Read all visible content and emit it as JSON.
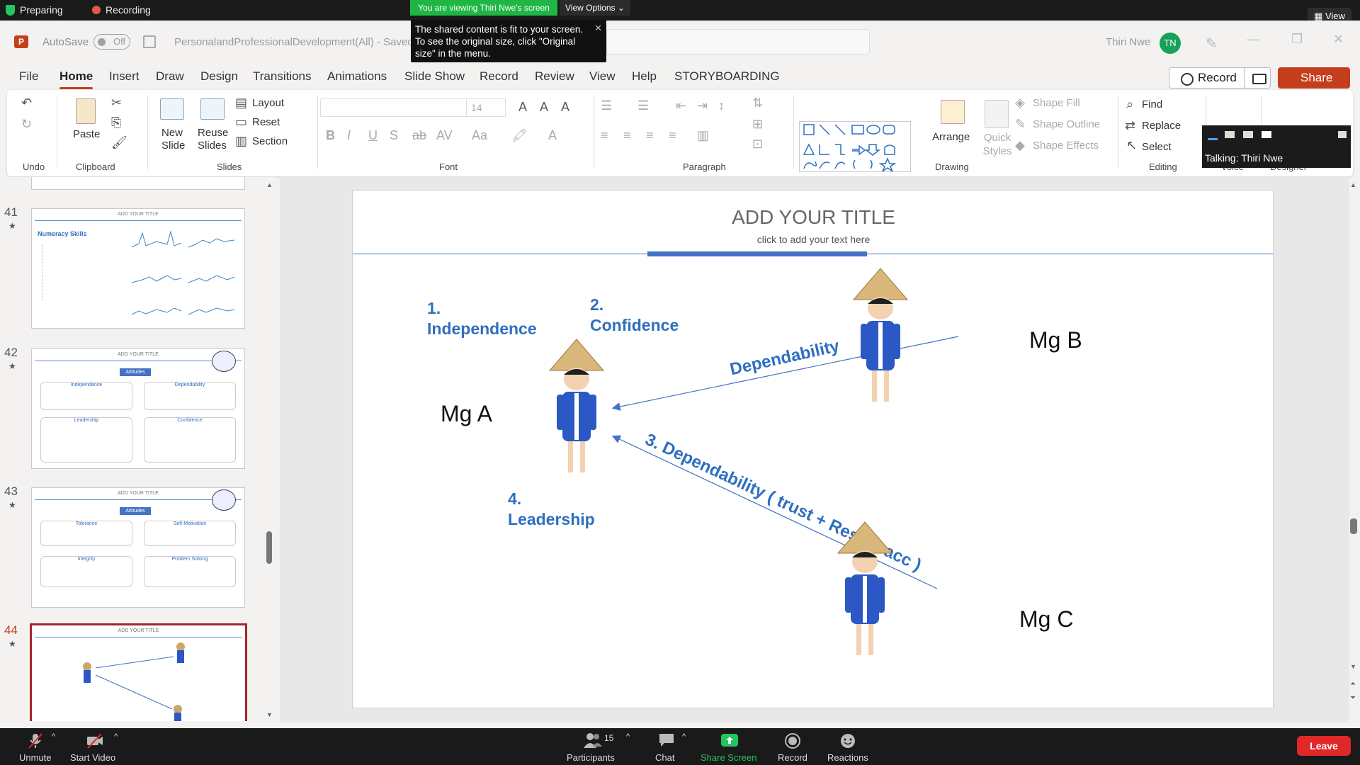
{
  "zoom": {
    "status_preparing": "Preparing",
    "status_recording": "Recording",
    "viewing_banner": "You are viewing Thiri Nwe's screen",
    "view_options": "View Options",
    "view_button": "View",
    "tooltip": "The shared content is fit to your screen. To see the original size, click \"Original size\" in the menu.",
    "talking": "Talking: Thiri Nwe",
    "bottom": {
      "unmute": "Unmute",
      "start_video": "Start Video",
      "participants": "Participants",
      "participants_count": "15",
      "chat": "Chat",
      "share_screen": "Share Screen",
      "record": "Record",
      "reactions": "Reactions",
      "leave": "Leave"
    }
  },
  "ppt": {
    "autosave": "AutoSave",
    "autosave_state": "Off",
    "doc_title": "PersonalandProfessionalDevelopment(All) - Saved",
    "user_name": "Thiri Nwe",
    "user_initials": "TN",
    "tabs": [
      "File",
      "Home",
      "Insert",
      "Draw",
      "Design",
      "Transitions",
      "Animations",
      "Slide Show",
      "Record",
      "Review",
      "View",
      "Help",
      "STORYBOARDING"
    ],
    "record_btn": "Record",
    "share_btn": "Share",
    "ribbon": {
      "undo": "Undo",
      "clipboard": "Clipboard",
      "paste": "Paste",
      "new_slide": "New Slide",
      "reuse_slides": "Reuse Slides",
      "layout": "Layout",
      "reset": "Reset",
      "section": "Section",
      "slides": "Slides",
      "font_size": "14",
      "font": "Font",
      "paragraph": "Paragraph",
      "arrange": "Arrange",
      "quick_styles": "Quick Styles",
      "shape_fill": "Shape Fill",
      "shape_outline": "Shape Outline",
      "shape_effects": "Shape Effects",
      "drawing": "Drawing",
      "find": "Find",
      "replace": "Replace",
      "select": "Select",
      "editing": "Editing",
      "voice": "Voice",
      "designer": "Designer"
    },
    "thumbnails": [
      {
        "num": "41",
        "title": "ADD YOUR TITLE",
        "heading": "Numeracy Skills"
      },
      {
        "num": "42",
        "title": "ADD YOUR TITLE",
        "tag": "Attitudes",
        "cards": [
          "Independence",
          "Dependability",
          "Leadership",
          "Confidence"
        ]
      },
      {
        "num": "43",
        "title": "ADD YOUR TITLE",
        "tag": "Attitudes",
        "cards": [
          "Tolerance",
          "Self-Motivation",
          "Integrity",
          "Problem Solving"
        ]
      },
      {
        "num": "44",
        "title": "ADD YOUR TITLE"
      }
    ],
    "slide": {
      "title": "ADD YOUR TITLE",
      "subtitle": "click to add your text here",
      "label1_num": "1.",
      "label1": "Independence",
      "label2_num": "2.",
      "label2": "Confidence",
      "label4_num": "4.",
      "label4": "Leadership",
      "arrow_top": "Dependability",
      "arrow_bottom": "3. Dependability ( trust + Resp + acc )",
      "mg_a": "Mg A",
      "mg_b": "Mg B",
      "mg_c": "Mg C"
    }
  }
}
